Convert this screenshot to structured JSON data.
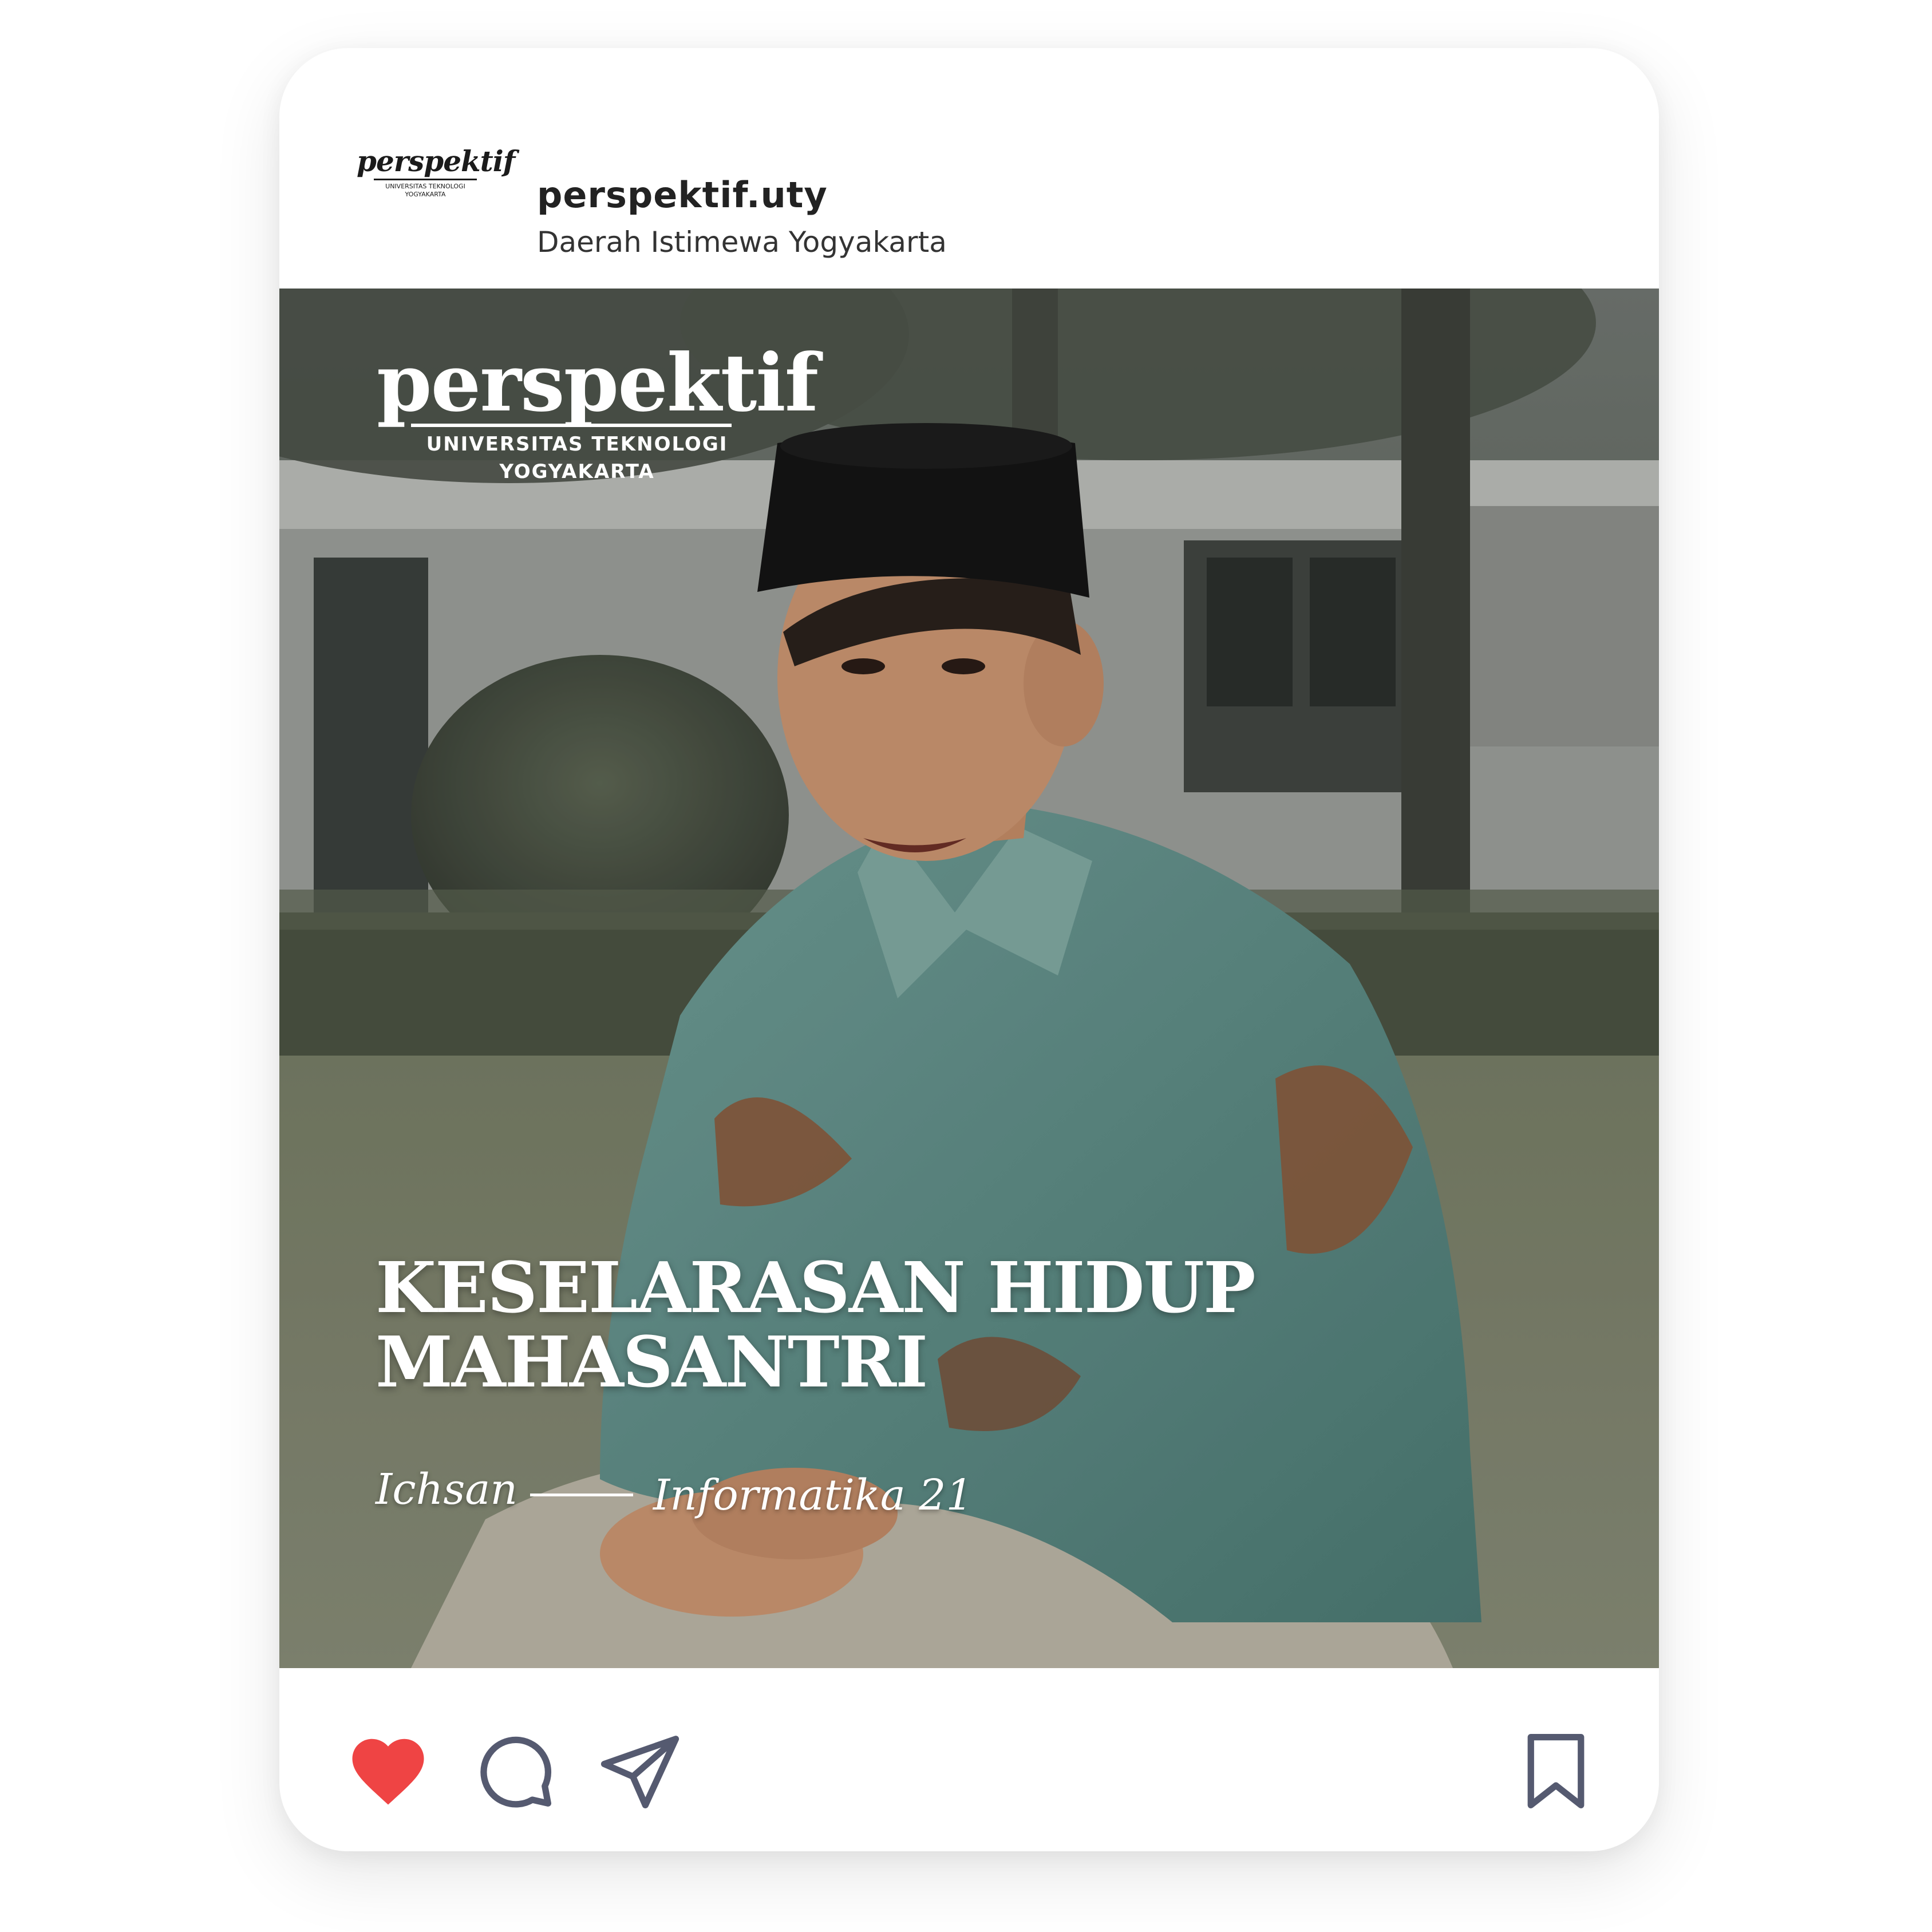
{
  "post": {
    "username": "perspektif.uty",
    "location": "Daerah Istimewa Yogyakarta",
    "avatar": {
      "logo_word": "perspektif",
      "logo_sub1": "UNIVERSITAS TEKNOLOGI",
      "logo_sub2": "YOGYAKARTA"
    },
    "image": {
      "logo_word": "perspektif",
      "logo_sub1": "UNIVERSITAS TEKNOLOGI",
      "logo_sub2": "YOGYAKARTA",
      "headline_line1": "KESELARASAN HIDUP",
      "headline_line2": "MAHASANTRI",
      "byline_name": "Ichsan",
      "byline_major": "Informatika 21"
    },
    "actions": {
      "like_icon": "heart-filled-icon",
      "like_color": "#ef4444",
      "comment_icon": "comment-bubble-icon",
      "share_icon": "paper-plane-icon",
      "save_icon": "bookmark-icon",
      "icon_color": "#555a70"
    }
  }
}
